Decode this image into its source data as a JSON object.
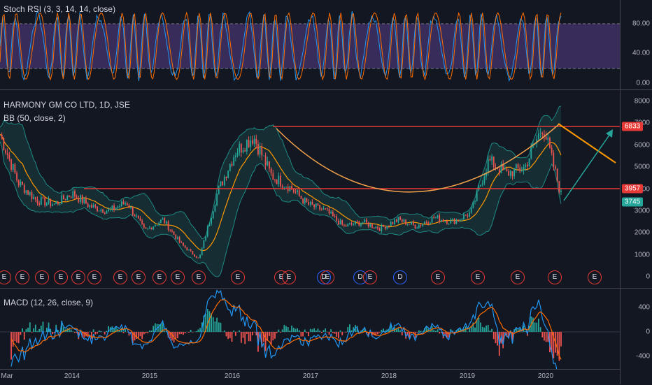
{
  "colors": {
    "background": "#131722",
    "rsi_k": "#2196f3",
    "rsi_d": "#ff6d00",
    "rsi_band": "#7e57c2",
    "price": "#26a69a",
    "bb_basis": "#ff9800",
    "bb_band": "#1e6e6b",
    "macd": "#2196f3",
    "signal": "#ff6d00",
    "hist_up": "#26a69a",
    "hist_down": "#ef5350",
    "resistance": "#e53935",
    "support_badge": "#26a69a",
    "arrow_up": "#26a69a",
    "arrow_down": "#ff9800",
    "cup": "#f0a04b"
  },
  "rsi_pane": {
    "label": "Stoch RSI (3, 3, 14, 14, close)",
    "ticks": [
      "80.00",
      "40.00",
      "0.00"
    ]
  },
  "price_pane": {
    "title": "HARMONY GM CO LTD, 1D, JSE",
    "indicator": "BB (50, close, 2)",
    "ticks": [
      "8000",
      "7000",
      "6000",
      "5000",
      "4000",
      "3000",
      "2000",
      "1000",
      "0"
    ],
    "badges": {
      "upper": "6833",
      "level": "3957",
      "last": "3745"
    }
  },
  "events": [
    "E",
    "E",
    "E",
    "E",
    "E",
    "E",
    "E",
    "E",
    "E",
    "E",
    "E",
    "E",
    "E",
    "E",
    "D",
    "E",
    "D",
    "E",
    "D",
    "E",
    "E",
    "E",
    "E",
    "E",
    "E"
  ],
  "macd_pane": {
    "label": "MACD (12, 26, close, 9)",
    "ticks": [
      "400",
      "0",
      "-400"
    ]
  },
  "x_axis": [
    "Mar",
    "2014",
    "2015",
    "2016",
    "2017",
    "2018",
    "2019",
    "2020"
  ],
  "chart_data": {
    "type": "line",
    "title": "HARMONY GM CO LTD, 1D, JSE",
    "x": [
      "2013-03",
      "2013-06",
      "2013-09",
      "2014-01",
      "2014-04",
      "2014-07",
      "2014-10",
      "2015-01",
      "2015-04",
      "2015-07",
      "2015-10",
      "2016-01",
      "2016-03",
      "2016-05",
      "2016-08",
      "2016-10",
      "2017-01",
      "2017-04",
      "2017-07",
      "2017-10",
      "2018-01",
      "2018-04",
      "2018-07",
      "2018-10",
      "2019-01",
      "2019-04",
      "2019-07",
      "2019-09",
      "2019-11",
      "2020-01",
      "2020-02",
      "2020-03"
    ],
    "series": [
      {
        "name": "HARMONY GM CO LTD",
        "values": [
          6500,
          4300,
          3500,
          3300,
          3800,
          3200,
          3000,
          3400,
          2100,
          2600,
          1500,
          800,
          3800,
          5700,
          6400,
          4600,
          4100,
          3300,
          3000,
          2300,
          2500,
          2200,
          2600,
          2300,
          2700,
          2500,
          2900,
          5300,
          4700,
          5000,
          6900,
          3745
        ]
      }
    ],
    "ylim": [
      0,
      8000
    ],
    "levels": [
      6833,
      3957
    ],
    "last_price": 3745
  }
}
